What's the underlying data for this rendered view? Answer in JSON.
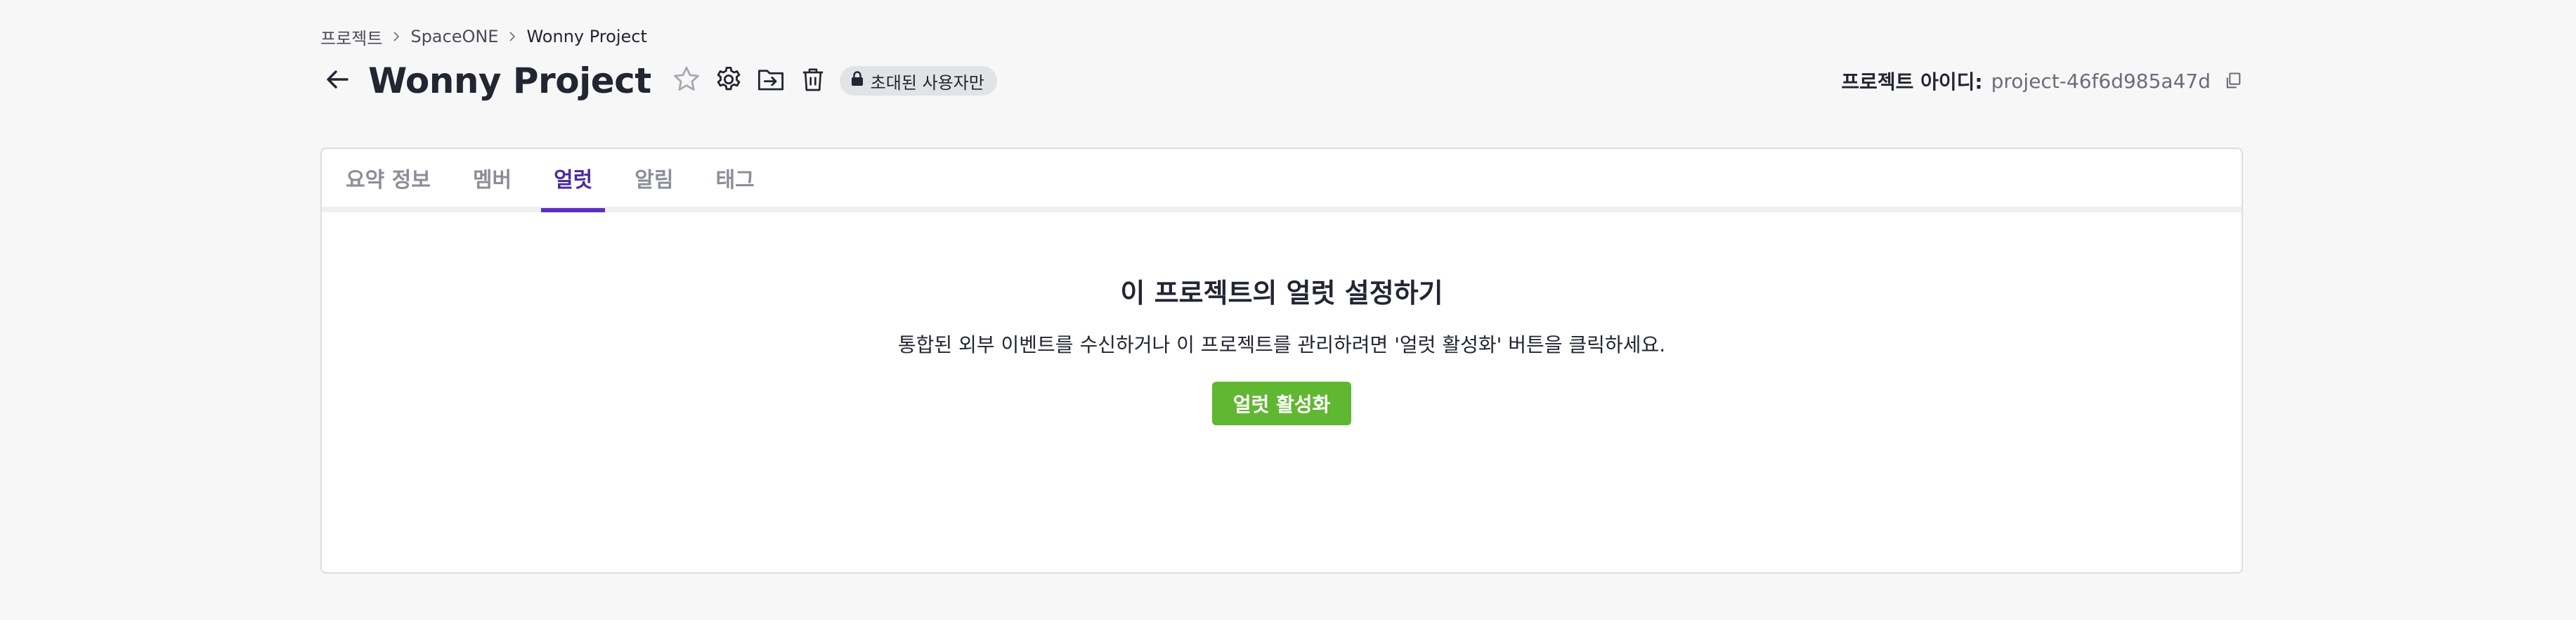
{
  "breadcrumb": {
    "items": [
      "프로젝트",
      "SpaceONE",
      "Wonny Project"
    ]
  },
  "header": {
    "title": "Wonny Project",
    "privacy_badge": "초대된 사용자만",
    "project_id_label": "프로젝트 아이디:",
    "project_id_value": "project-46f6d985a47d"
  },
  "tabs": [
    {
      "label": "요약 정보",
      "active": false
    },
    {
      "label": "멤버",
      "active": false
    },
    {
      "label": "얼럿",
      "active": true
    },
    {
      "label": "알림",
      "active": false
    },
    {
      "label": "태그",
      "active": false
    }
  ],
  "alert_panel": {
    "heading": "이 프로젝트의 얼럿 설정하기",
    "description": "통합된 외부 이벤트를 수신하거나 이 프로젝트를 관리하려면 '얼럿 활성화' 버튼을 클릭하세요.",
    "enable_button": "얼럿 활성화"
  },
  "colors": {
    "accent_purple": "#5b2fc4",
    "button_green": "#60b731",
    "background": "#f7f7f7"
  },
  "icons": [
    "arrow-left-icon",
    "star-icon",
    "gear-icon",
    "move-folder-icon",
    "trash-icon",
    "lock-icon",
    "copy-icon",
    "chevron-right-icon"
  ]
}
